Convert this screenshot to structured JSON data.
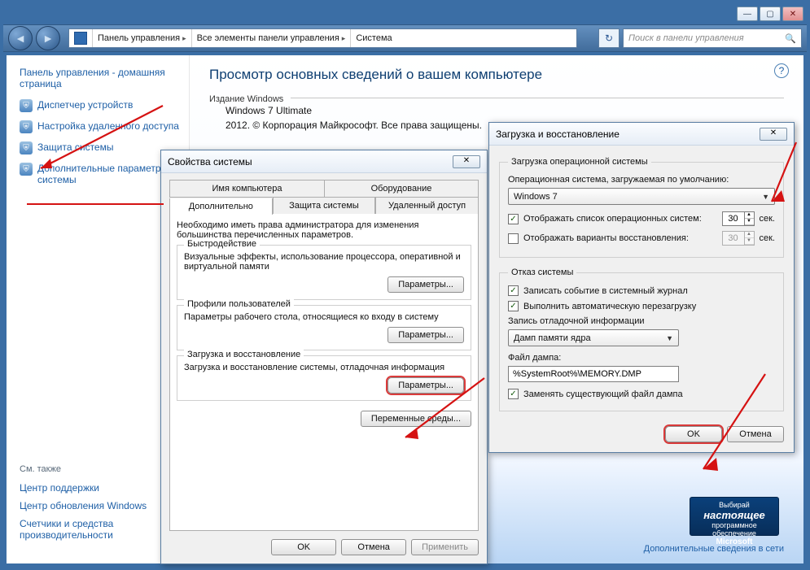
{
  "window": {
    "breadcrumbs": [
      "Панель управления",
      "Все элементы панели управления",
      "Система"
    ],
    "search_placeholder": "Поиск в панели управления"
  },
  "sidebar": {
    "home": "Панель управления - домашняя страница",
    "links": [
      "Диспетчер устройств",
      "Настройка удаленного доступа",
      "Защита системы",
      "Дополнительные параметры системы"
    ],
    "see_also": "См. также",
    "footer_links": [
      "Центр поддержки",
      "Центр обновления Windows",
      "Счетчики и средства производительности"
    ]
  },
  "main": {
    "title": "Просмотр основных сведений о вашем компьютере",
    "edition_lbl": "Издание Windows",
    "edition_name": "Windows 7 Ultimate",
    "copyright": "2012. © Корпорация Майкрософт. Все права защищены.",
    "bottom_link": "Дополнительные сведения в сети",
    "genuine": {
      "small1": "Выбирай",
      "big": "настоящее",
      "small2": "программное обеспечение",
      "brand": "Microsoft"
    }
  },
  "sysprops": {
    "title": "Свойства системы",
    "tabs_top": [
      "Имя компьютера",
      "Оборудование"
    ],
    "tabs_bot": [
      "Дополнительно",
      "Защита системы",
      "Удаленный доступ"
    ],
    "note": "Необходимо иметь права администратора для изменения большинства перечисленных параметров.",
    "perf": {
      "legend": "Быстродействие",
      "text": "Визуальные эффекты, использование процессора, оперативной и виртуальной памяти",
      "btn": "Параметры..."
    },
    "profiles": {
      "legend": "Профили пользователей",
      "text": "Параметры рабочего стола, относящиеся ко входу в систему",
      "btn": "Параметры..."
    },
    "startup": {
      "legend": "Загрузка и восстановление",
      "text": "Загрузка и восстановление системы, отладочная информация",
      "btn": "Параметры..."
    },
    "envvars": "Переменные среды...",
    "ok": "OK",
    "cancel": "Отмена",
    "apply": "Применить"
  },
  "startrec": {
    "title": "Загрузка и восстановление",
    "fs1": {
      "legend": "Загрузка операционной системы",
      "default_lbl": "Операционная система, загружаемая по умолчанию:",
      "default_os": "Windows 7",
      "chk1": "Отображать список операционных систем:",
      "chk1_val": "30",
      "sec": "сек.",
      "chk2": "Отображать варианты восстановления:",
      "chk2_val": "30"
    },
    "fs2": {
      "legend": "Отказ системы",
      "chk_log": "Записать событие в системный журнал",
      "chk_reboot": "Выполнить автоматическую перезагрузку",
      "debug_lbl": "Запись отладочной информации",
      "debug_combo": "Дамп памяти ядра",
      "dumpfile_lbl": "Файл дампа:",
      "dumpfile": "%SystemRoot%\\MEMORY.DMP",
      "chk_overwrite": "Заменять существующий файл дампа"
    },
    "ok": "OK",
    "cancel": "Отмена"
  }
}
